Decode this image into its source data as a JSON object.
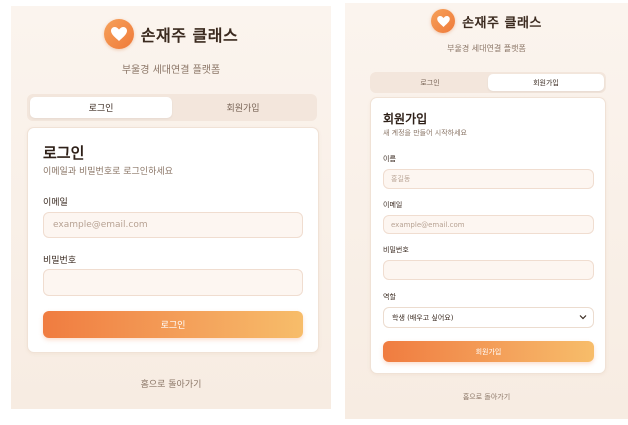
{
  "brand": {
    "name": "손재주 클래스",
    "tagline": "부울경 세대연결 플랫폼",
    "logo_icon": "heart-icon",
    "accent": "#ef7a3a"
  },
  "tabs": {
    "login": "로그인",
    "signup": "회원가입"
  },
  "login": {
    "title": "로그인",
    "description": "이메일과 비밀번호로 로그인하세요",
    "email_label": "이메일",
    "email_placeholder": "example@email.com",
    "password_label": "비밀번호",
    "password_value": "",
    "submit": "로그인",
    "home_link": "홈으로 돌아가기"
  },
  "signup": {
    "title": "회원가입",
    "description": "새 계정을 만들어 시작하세요",
    "name_label": "이름",
    "name_placeholder": "홍길동",
    "email_label": "이메일",
    "email_placeholder": "example@email.com",
    "password_label": "비밀번호",
    "password_value": "",
    "role_label": "역할",
    "role_selected": "학생 (배우고 싶어요)",
    "submit": "회원가입",
    "home_link": "홈으로 돌아가기"
  }
}
